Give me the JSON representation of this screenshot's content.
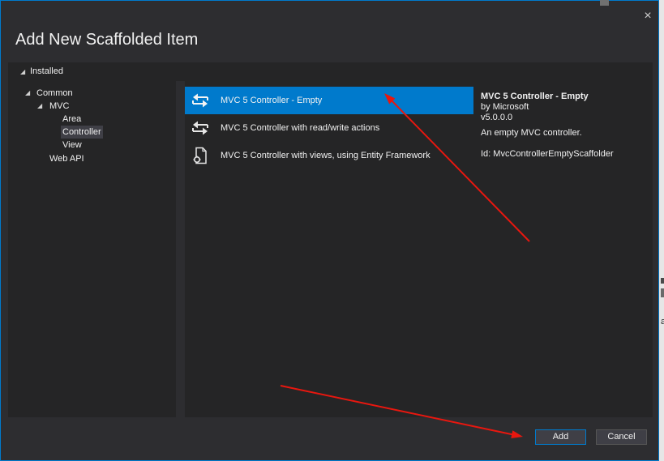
{
  "theme": {
    "accent": "#007acc",
    "dialog_bg": "#2d2d30",
    "panel_bg": "#252526",
    "text": "#f1f1f1",
    "button_bg": "#3f3f46",
    "button_border": "#555555",
    "tree_selected": "#3f3f46",
    "annotation": "#e8170f",
    "backdrop": "#e6e6e6"
  },
  "window": {
    "title": "Add New Scaffolded Item",
    "close_glyph": "×",
    "close_icon": "close-icon"
  },
  "tree": {
    "expander_glyph": "◢",
    "expander_icon": "expanded-triangle-icon",
    "header": {
      "label": "Installed",
      "expanded": true
    },
    "items": [
      {
        "label": "Common",
        "level": 1,
        "expanded": true
      },
      {
        "label": "MVC",
        "level": 2,
        "expanded": true
      },
      {
        "label": "Area",
        "level": 3
      },
      {
        "label": "Controller",
        "level": 3,
        "selected": true
      },
      {
        "label": "View",
        "level": 3
      },
      {
        "label": "Web API",
        "level": 2
      }
    ]
  },
  "templates": {
    "items": [
      {
        "label": "MVC 5 Controller - Empty",
        "icon": "controller-icon",
        "selected": true
      },
      {
        "label": "MVC 5 Controller with read/write actions",
        "icon": "controller-icon"
      },
      {
        "label": "MVC 5 Controller with views, using Entity Framework",
        "icon": "controller-with-views-icon"
      }
    ]
  },
  "details": {
    "title": "MVC 5 Controller - Empty",
    "author": "by Microsoft",
    "version": "v5.0.0.0",
    "description": "An empty MVC controller.",
    "id_text": "Id: MvcControllerEmptyScaffolder"
  },
  "buttons": {
    "add": "Add",
    "cancel": "Cancel"
  },
  "backdrop": {
    "fragment_text": "a"
  }
}
